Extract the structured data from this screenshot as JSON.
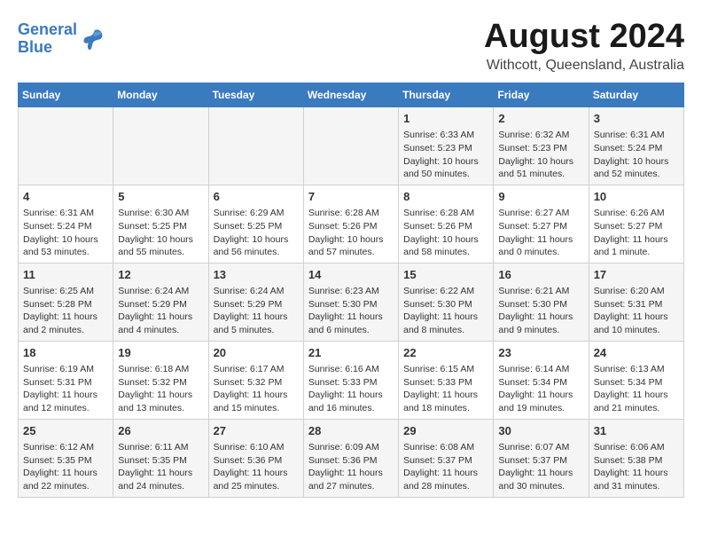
{
  "header": {
    "logo_line1": "General",
    "logo_line2": "Blue",
    "main_title": "August 2024",
    "subtitle": "Withcott, Queensland, Australia"
  },
  "days_of_week": [
    "Sunday",
    "Monday",
    "Tuesday",
    "Wednesday",
    "Thursday",
    "Friday",
    "Saturday"
  ],
  "weeks": [
    [
      {
        "day": "",
        "info": ""
      },
      {
        "day": "",
        "info": ""
      },
      {
        "day": "",
        "info": ""
      },
      {
        "day": "",
        "info": ""
      },
      {
        "day": "1",
        "info": "Sunrise: 6:33 AM\nSunset: 5:23 PM\nDaylight: 10 hours\nand 50 minutes."
      },
      {
        "day": "2",
        "info": "Sunrise: 6:32 AM\nSunset: 5:23 PM\nDaylight: 10 hours\nand 51 minutes."
      },
      {
        "day": "3",
        "info": "Sunrise: 6:31 AM\nSunset: 5:24 PM\nDaylight: 10 hours\nand 52 minutes."
      }
    ],
    [
      {
        "day": "4",
        "info": "Sunrise: 6:31 AM\nSunset: 5:24 PM\nDaylight: 10 hours\nand 53 minutes."
      },
      {
        "day": "5",
        "info": "Sunrise: 6:30 AM\nSunset: 5:25 PM\nDaylight: 10 hours\nand 55 minutes."
      },
      {
        "day": "6",
        "info": "Sunrise: 6:29 AM\nSunset: 5:25 PM\nDaylight: 10 hours\nand 56 minutes."
      },
      {
        "day": "7",
        "info": "Sunrise: 6:28 AM\nSunset: 5:26 PM\nDaylight: 10 hours\nand 57 minutes."
      },
      {
        "day": "8",
        "info": "Sunrise: 6:28 AM\nSunset: 5:26 PM\nDaylight: 10 hours\nand 58 minutes."
      },
      {
        "day": "9",
        "info": "Sunrise: 6:27 AM\nSunset: 5:27 PM\nDaylight: 11 hours\nand 0 minutes."
      },
      {
        "day": "10",
        "info": "Sunrise: 6:26 AM\nSunset: 5:27 PM\nDaylight: 11 hours\nand 1 minute."
      }
    ],
    [
      {
        "day": "11",
        "info": "Sunrise: 6:25 AM\nSunset: 5:28 PM\nDaylight: 11 hours\nand 2 minutes."
      },
      {
        "day": "12",
        "info": "Sunrise: 6:24 AM\nSunset: 5:29 PM\nDaylight: 11 hours\nand 4 minutes."
      },
      {
        "day": "13",
        "info": "Sunrise: 6:24 AM\nSunset: 5:29 PM\nDaylight: 11 hours\nand 5 minutes."
      },
      {
        "day": "14",
        "info": "Sunrise: 6:23 AM\nSunset: 5:30 PM\nDaylight: 11 hours\nand 6 minutes."
      },
      {
        "day": "15",
        "info": "Sunrise: 6:22 AM\nSunset: 5:30 PM\nDaylight: 11 hours\nand 8 minutes."
      },
      {
        "day": "16",
        "info": "Sunrise: 6:21 AM\nSunset: 5:30 PM\nDaylight: 11 hours\nand 9 minutes."
      },
      {
        "day": "17",
        "info": "Sunrise: 6:20 AM\nSunset: 5:31 PM\nDaylight: 11 hours\nand 10 minutes."
      }
    ],
    [
      {
        "day": "18",
        "info": "Sunrise: 6:19 AM\nSunset: 5:31 PM\nDaylight: 11 hours\nand 12 minutes."
      },
      {
        "day": "19",
        "info": "Sunrise: 6:18 AM\nSunset: 5:32 PM\nDaylight: 11 hours\nand 13 minutes."
      },
      {
        "day": "20",
        "info": "Sunrise: 6:17 AM\nSunset: 5:32 PM\nDaylight: 11 hours\nand 15 minutes."
      },
      {
        "day": "21",
        "info": "Sunrise: 6:16 AM\nSunset: 5:33 PM\nDaylight: 11 hours\nand 16 minutes."
      },
      {
        "day": "22",
        "info": "Sunrise: 6:15 AM\nSunset: 5:33 PM\nDaylight: 11 hours\nand 18 minutes."
      },
      {
        "day": "23",
        "info": "Sunrise: 6:14 AM\nSunset: 5:34 PM\nDaylight: 11 hours\nand 19 minutes."
      },
      {
        "day": "24",
        "info": "Sunrise: 6:13 AM\nSunset: 5:34 PM\nDaylight: 11 hours\nand 21 minutes."
      }
    ],
    [
      {
        "day": "25",
        "info": "Sunrise: 6:12 AM\nSunset: 5:35 PM\nDaylight: 11 hours\nand 22 minutes."
      },
      {
        "day": "26",
        "info": "Sunrise: 6:11 AM\nSunset: 5:35 PM\nDaylight: 11 hours\nand 24 minutes."
      },
      {
        "day": "27",
        "info": "Sunrise: 6:10 AM\nSunset: 5:36 PM\nDaylight: 11 hours\nand 25 minutes."
      },
      {
        "day": "28",
        "info": "Sunrise: 6:09 AM\nSunset: 5:36 PM\nDaylight: 11 hours\nand 27 minutes."
      },
      {
        "day": "29",
        "info": "Sunrise: 6:08 AM\nSunset: 5:37 PM\nDaylight: 11 hours\nand 28 minutes."
      },
      {
        "day": "30",
        "info": "Sunrise: 6:07 AM\nSunset: 5:37 PM\nDaylight: 11 hours\nand 30 minutes."
      },
      {
        "day": "31",
        "info": "Sunrise: 6:06 AM\nSunset: 5:38 PM\nDaylight: 11 hours\nand 31 minutes."
      }
    ]
  ]
}
